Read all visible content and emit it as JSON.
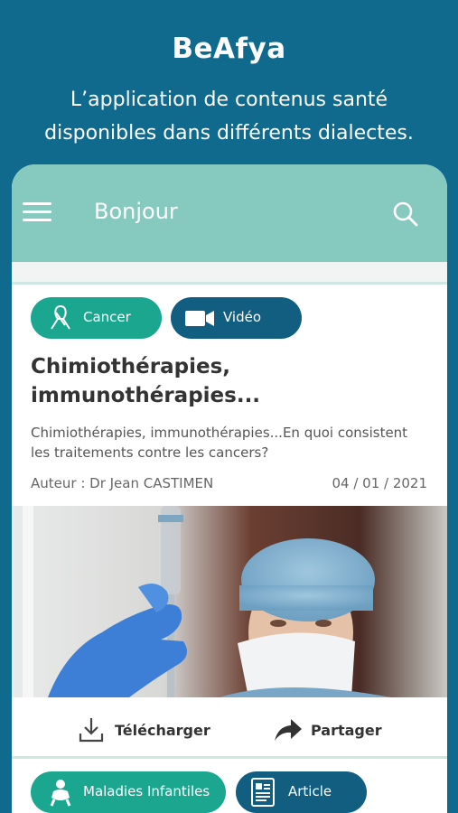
{
  "header": {
    "app_name": "BeAfya",
    "tagline": "L’application de contenus santé disponibles dans différents dialectes."
  },
  "appbar": {
    "title": "Bonjour",
    "menu_icon": "hamburger-menu-icon",
    "search_icon": "search-icon"
  },
  "article": {
    "category": "Cancer",
    "category_icon": "cancer-ribbon-icon",
    "type": "Vidéo",
    "type_icon": "video-camera-icon",
    "title": "Chimiothérapies, immunothérapies...",
    "description": "Chimiothérapies, immunothérapies...En quoi consistent les traitements contre les cancers?",
    "author": "Auteur : Dr Jean CASTIMEN",
    "date": "04 / 01 / 2021",
    "download_label": "Télécharger",
    "share_label": "Partager"
  },
  "next_article": {
    "category": "Maladies Infantiles",
    "category_icon": "baby-icon",
    "type": "Article",
    "type_icon": "document-icon"
  },
  "colors": {
    "background": "#0f6a8e",
    "appbar": "#86c9bf",
    "chip_teal": "#1aa68f",
    "chip_blue": "#115e80"
  }
}
